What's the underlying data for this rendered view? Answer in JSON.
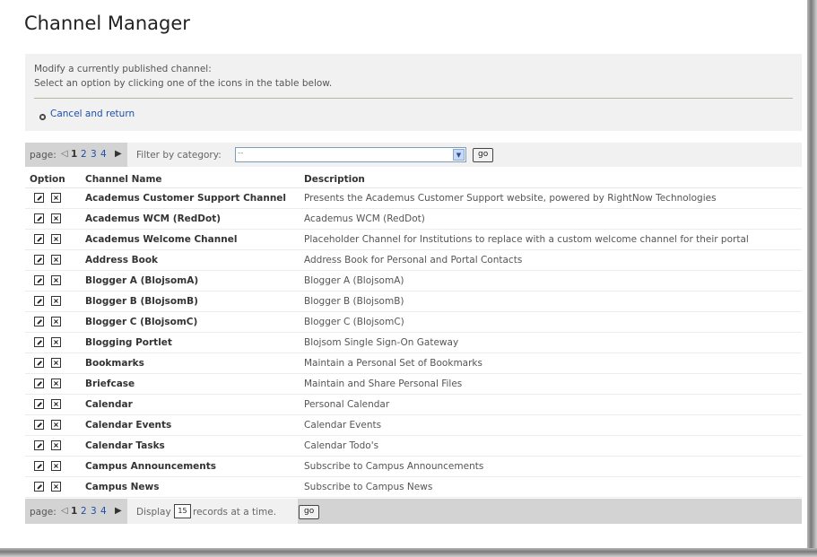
{
  "page": {
    "title": "Channel Manager",
    "info_line1": "Modify a currently published channel:",
    "info_line2": "Select an option by clicking one of the icons in the table below.",
    "cancel_link": "Cancel and return"
  },
  "pager": {
    "label": "page:",
    "pages": [
      "1",
      "2",
      "3",
      "4"
    ],
    "current_page": "1",
    "first_icon": "first-page-icon",
    "next_icon": "next-page-icon"
  },
  "filter": {
    "label": "Filter by category:",
    "selected": "--",
    "go_label": "go"
  },
  "display": {
    "prefix": "Display",
    "value": "15",
    "suffix": "records at a time.",
    "go_label": "go"
  },
  "table": {
    "headers": [
      "Option",
      "Channel Name",
      "Description"
    ],
    "rows": [
      {
        "name": "Academus Customer Support Channel",
        "desc": "Presents the Academus Customer Support website, powered by RightNow Technologies"
      },
      {
        "name": "Academus WCM (RedDot)",
        "desc": "Academus WCM (RedDot)"
      },
      {
        "name": "Academus Welcome Channel",
        "desc": "Placeholder Channel for Institutions to replace with a custom welcome channel for their portal"
      },
      {
        "name": "Address Book",
        "desc": "Address Book for Personal and Portal Contacts"
      },
      {
        "name": "Blogger A (BlojsomA)",
        "desc": "Blogger A (BlojsomA)"
      },
      {
        "name": "Blogger B (BlojsomB)",
        "desc": "Blogger B (BlojsomB)"
      },
      {
        "name": "Blogger C (BlojsomC)",
        "desc": "Blogger C (BlojsomC)"
      },
      {
        "name": "Blogging Portlet",
        "desc": "Blojsom Single Sign-On Gateway"
      },
      {
        "name": "Bookmarks",
        "desc": "Maintain a Personal Set of Bookmarks"
      },
      {
        "name": "Briefcase",
        "desc": "Maintain and Share Personal Files"
      },
      {
        "name": "Calendar",
        "desc": "Personal Calendar"
      },
      {
        "name": "Calendar Events",
        "desc": "Calendar Events"
      },
      {
        "name": "Calendar Tasks",
        "desc": "Calendar Todo's"
      },
      {
        "name": "Campus Announcements",
        "desc": "Subscribe to Campus Announcements"
      },
      {
        "name": "Campus News",
        "desc": "Subscribe to Campus News"
      }
    ]
  },
  "icons": {
    "edit": "edit-icon",
    "delete": "delete-icon",
    "bullet": "bullet-icon"
  },
  "colors": {
    "link": "#1f4ea8",
    "pager_bar": "#d3d3d3",
    "panel": "#f1f1f1"
  }
}
